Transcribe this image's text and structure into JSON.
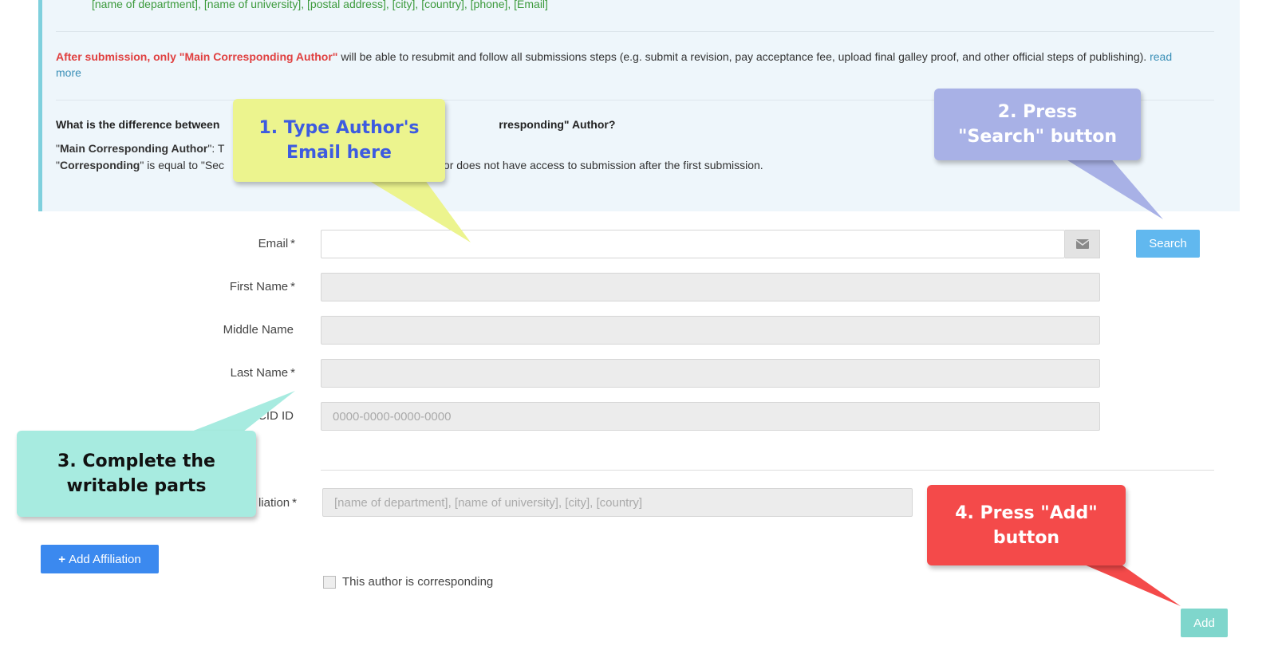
{
  "info": {
    "address_line": "[name of department], [name of university], [postal address], [city], [country], [phone], [Email]",
    "submit_note_bold": "After submission, only \"Main Corresponding Author\"",
    "submit_note_rest": " will be able to resubmit and follow all submissions steps (e.g. submit a revision, pay acceptance fee, upload final galley proof, and other official steps of publishing).",
    "read_more": "read more",
    "question_start": "What is the difference between",
    "question_end": "rresponding\" Author?",
    "main_def_bold": "Main Corresponding Author",
    "main_def_start": "\"",
    "main_def_rest": "\": T",
    "corr_def_quote": "\"",
    "corr_def_bold": "Corresponding",
    "corr_def_rest": "\" is equal to \"Sec",
    "corr_def_tail": "f author does not have access to submission after the first submission."
  },
  "form": {
    "email_label": "Email",
    "first_name_label": "First Name",
    "middle_name_label": "Middle Name",
    "last_name_label": "Last Name",
    "orcid_label": "RCID ID",
    "orcid_placeholder": "0000-0000-0000-0000",
    "affiliation_label": "liation",
    "affiliation_placeholder": "[name of department], [name of university], [city], [country]",
    "required_mark": "*",
    "search_button": "Search",
    "add_affiliation_button": "Add Affiliation",
    "corresponding_checkbox_label": "This author is corresponding",
    "add_button": "Add"
  },
  "callouts": {
    "step1_line1": "1. Type Author's",
    "step1_line2": "Email here",
    "step2_line1": "2. Press",
    "step2_line2": "\"Search\" button",
    "step3_line1": "3. Complete the",
    "step3_line2": "writable parts",
    "step4_line1": "4. Press \"Add\"",
    "step4_line2": "button"
  },
  "colors": {
    "search_button": "#61b8ef",
    "add_affiliation_button": "#3b89ef",
    "add_button": "#7fd6cc",
    "callout_yellow": "#ecf48e",
    "callout_purple": "#a8b1e6",
    "callout_teal": "#a7ebe0",
    "callout_red": "#f44a4a"
  },
  "icons": {
    "email_addon": "envelope-icon",
    "add_affiliation": "plus-icon"
  }
}
